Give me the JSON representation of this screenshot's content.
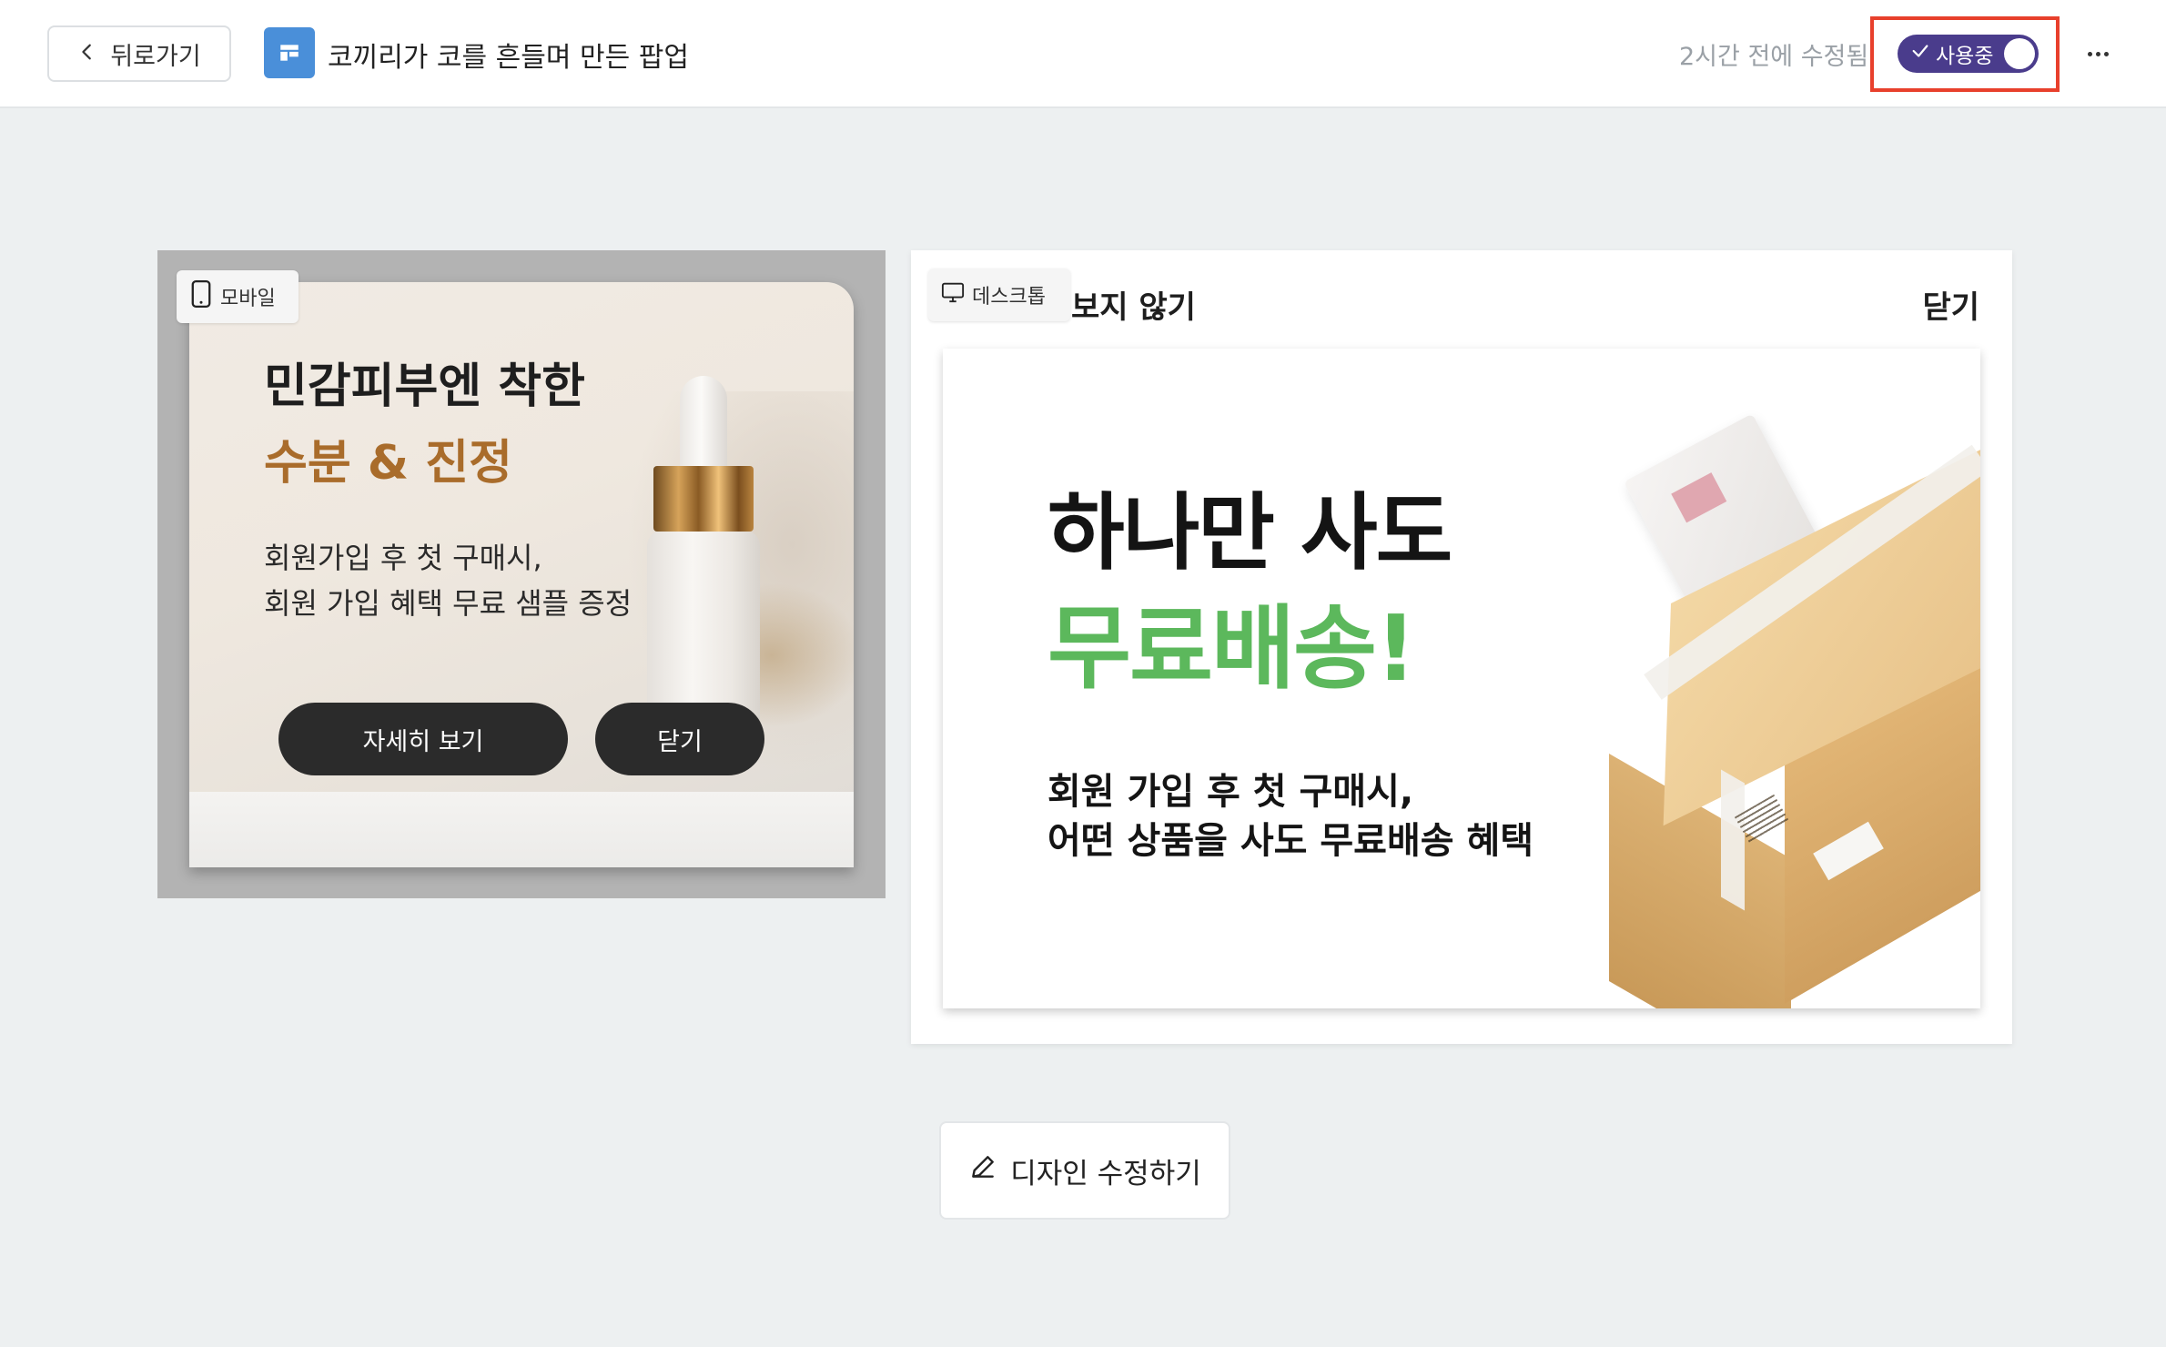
{
  "header": {
    "back_label": "뒤로가기",
    "title": "코끼리가 코를 흔들며 만든 팝업",
    "modified": "2시간 전에 수정됨",
    "status_label": "사용중",
    "status_on": true,
    "accent_color": "#4a3c8c",
    "highlight_color": "#e8402c"
  },
  "mobile": {
    "device_label": "모바일",
    "headline": "민감피부엔 착한",
    "subheadline": "수분 & 진정",
    "body_line1": "회원가입 후 첫 구매시,",
    "body_line2": "회원 가입 혜택 무료 샘플 증정",
    "detail_button": "자세히 보기",
    "close_button": "닫기"
  },
  "desktop": {
    "device_label": "데스크톱",
    "dont_show_label": "보지 않기",
    "close_label": "닫기",
    "headline": "하나만 사도",
    "subheadline": "무료배송!",
    "body_line1": "회원 가입 후 첫 구매시,",
    "body_line2": "어떤 상품을 사도 무료배송 혜택",
    "sub_color": "#5cb85c"
  },
  "footer": {
    "edit_label": "디자인 수정하기"
  },
  "icons": {
    "back": "chevron-left-icon",
    "page": "layout-icon",
    "status": "check-icon",
    "more": "more-horizontal-icon",
    "mobile": "smartphone-icon",
    "desktop": "monitor-icon",
    "edit": "pencil-icon"
  }
}
